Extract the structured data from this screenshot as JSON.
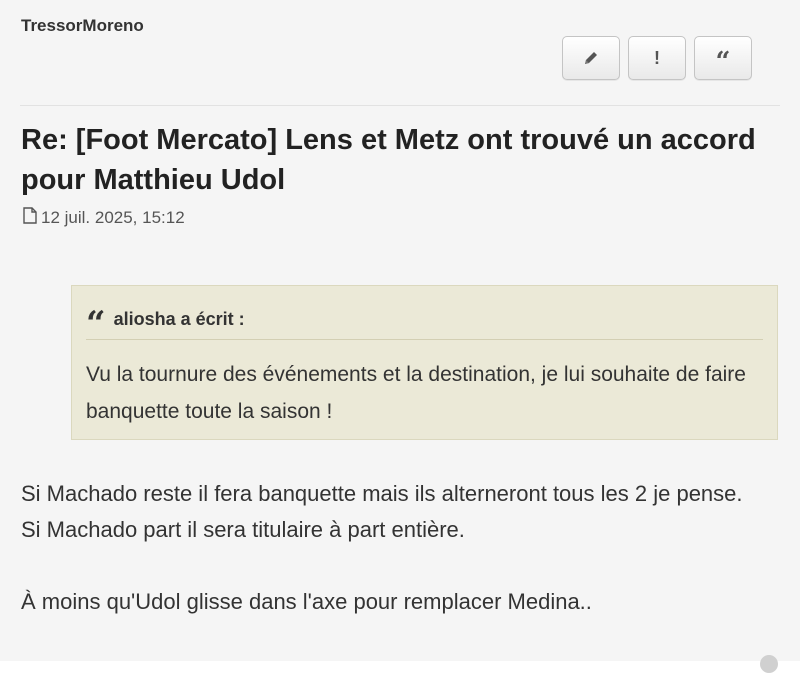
{
  "post": {
    "author": "TressorMoreno",
    "actions": {
      "edit_icon": "pencil-icon",
      "report_label": "!",
      "quote_label": "“"
    },
    "title": "Re: [Foot Mercato] Lens et Metz ont trouvé un accord pour Matthieu Udol",
    "date": "12 juil. 2025, 15:12",
    "quote": {
      "author_line": "aliosha a écrit :",
      "text": "Vu la tournure des événements et la destination, je lui souhaite de faire banquette toute la saison !"
    },
    "body": {
      "line1": "Si Machado reste il fera banquette mais ils alterneront tous les 2 je pense.",
      "line2": "Si Machado part il sera titulaire à part entière.",
      "line3": "À moins qu'Udol glisse dans l'axe pour remplacer Medina.."
    }
  }
}
